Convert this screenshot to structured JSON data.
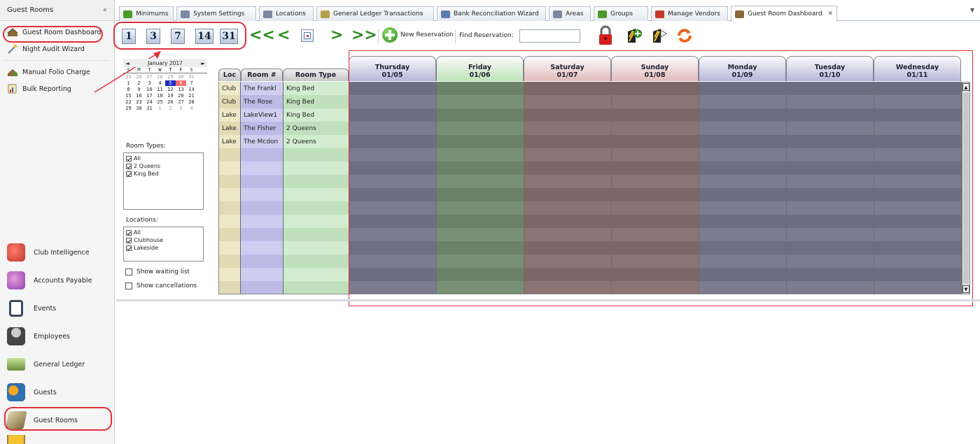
{
  "sidebar": {
    "title": "Guest Rooms",
    "collapse": "«",
    "items": [
      {
        "label": "Guest Room Dashboard",
        "icon": "house-icon"
      },
      {
        "label": "Night Audit Wizard",
        "icon": "wand-icon"
      },
      {
        "label": "Manual Folio Charge",
        "icon": "folio-icon"
      },
      {
        "label": "Bulk Reporting",
        "icon": "report-icon"
      }
    ],
    "modules": [
      {
        "label": "Club Intelligence",
        "icon": "club-intelligence-icon",
        "color": "#c0392b"
      },
      {
        "label": "Accounts Payable",
        "icon": "accounts-payable-icon",
        "color": "#8e44ad"
      },
      {
        "label": "Events",
        "icon": "events-icon",
        "color": "#3a4a63"
      },
      {
        "label": "Employees",
        "icon": "employees-icon",
        "color": "#555555"
      },
      {
        "label": "General Ledger",
        "icon": "general-ledger-icon",
        "color": "#6b8f3a"
      },
      {
        "label": "Guests",
        "icon": "guests-icon",
        "color": "#d35400"
      },
      {
        "label": "Guest Rooms",
        "icon": "guest-rooms-icon",
        "color": "#7d6a3c"
      }
    ]
  },
  "tabs": [
    {
      "label": "Minimums",
      "icon": "minimums-icon",
      "color": "#4c9a2a"
    },
    {
      "label": "System Settings",
      "icon": "settings-icon",
      "color": "#7b8aa0"
    },
    {
      "label": "Locations",
      "icon": "locations-icon",
      "color": "#7b8aa0"
    },
    {
      "label": "General Ledger Transactions",
      "icon": "ledger-icon",
      "color": "#b8a04a"
    },
    {
      "label": "Bank Reconciliation Wizard",
      "icon": "wand-icon",
      "color": "#5b7fb0"
    },
    {
      "label": "Areas",
      "icon": "areas-icon",
      "color": "#7b8aa0"
    },
    {
      "label": "Groups",
      "icon": "groups-icon",
      "color": "#4c9a2a"
    },
    {
      "label": "Manage Vendors",
      "icon": "vendors-icon",
      "color": "#c0392b"
    },
    {
      "label": "Guest Room Dashboard",
      "icon": "house-icon",
      "color": "#8a6a3a",
      "active": true,
      "close": "✕"
    }
  ],
  "toolbar": {
    "day_buttons": [
      "1",
      "3",
      "7",
      "14",
      "31"
    ],
    "prev_week": "<<",
    "prev_day": "<",
    "next_day": ">",
    "next_week": ">>",
    "new_reservation": "New Reservation",
    "find_reservation_label": "Find Reservation:",
    "find_reservation_value": ""
  },
  "mini_calendar": {
    "month": "January 2017",
    "prev": "◄",
    "next": "►",
    "weekdays": [
      "S",
      "M",
      "T",
      "W",
      "T",
      "F",
      "S"
    ],
    "weeks": [
      [
        "25",
        "26",
        "27",
        "28",
        "29",
        "30",
        "31"
      ],
      [
        "1",
        "2",
        "3",
        "4",
        "5",
        "6",
        "7"
      ],
      [
        "8",
        "9",
        "10",
        "11",
        "12",
        "13",
        "14"
      ],
      [
        "15",
        "16",
        "17",
        "18",
        "19",
        "20",
        "21"
      ],
      [
        "22",
        "23",
        "24",
        "25",
        "26",
        "27",
        "28"
      ],
      [
        "29",
        "30",
        "31",
        "1",
        "2",
        "3",
        "4"
      ]
    ],
    "selected_start": "5",
    "selected_end": "6"
  },
  "room_types": {
    "label": "Room Types:",
    "options": [
      {
        "label": "All",
        "checked": true
      },
      {
        "label": "2 Queens",
        "checked": true
      },
      {
        "label": "King Bed",
        "checked": true
      }
    ]
  },
  "locations": {
    "label": "Locations:",
    "options": [
      {
        "label": "All",
        "checked": true
      },
      {
        "label": "Clubhouse",
        "checked": true
      },
      {
        "label": "Lakeside",
        "checked": true
      }
    ]
  },
  "options": {
    "show_waiting_list": "Show waiting list",
    "show_cancellations": "Show cancellations"
  },
  "grid": {
    "columns": {
      "loc": "Loc",
      "room": "Room #",
      "type": "Room Type"
    },
    "days": [
      {
        "day": "Thursday",
        "date": "01/05",
        "color": "#b7b5d9",
        "cell": "#6f6d82",
        "cell_alt": "#7d7b90"
      },
      {
        "day": "Friday",
        "date": "01/06",
        "color": "#bfe3b9",
        "cell": "#6b8268",
        "cell_alt": "#789076"
      },
      {
        "day": "Saturday",
        "date": "01/07",
        "color": "#e3bcbc",
        "cell": "#7e6666",
        "cell_alt": "#8c7474"
      },
      {
        "day": "Sunday",
        "date": "01/08",
        "color": "#e3bcbc",
        "cell": "#7e6666",
        "cell_alt": "#8c7474"
      },
      {
        "day": "Monday",
        "date": "01/09",
        "color": "#b7b5d9",
        "cell": "#6f6d82",
        "cell_alt": "#7d7b90"
      },
      {
        "day": "Tuesday",
        "date": "01/10",
        "color": "#b7b5d9",
        "cell": "#6f6d82",
        "cell_alt": "#7d7b90"
      },
      {
        "day": "Wednesday",
        "date": "01/11",
        "color": "#b7b5d9",
        "cell": "#6f6d82",
        "cell_alt": "#7d7b90"
      }
    ],
    "rooms": [
      {
        "loc": "Club",
        "room": "The Frankl",
        "type": "King Bed"
      },
      {
        "loc": "Club",
        "room": "The Rose",
        "type": "King Bed"
      },
      {
        "loc": "Lake",
        "room": "LakeView1",
        "type": "King Bed"
      },
      {
        "loc": "Lake",
        "room": "The Fisher",
        "type": "2 Queens"
      },
      {
        "loc": "Lake",
        "room": "The Mcdon",
        "type": "2 Queens"
      }
    ],
    "row_count": 16,
    "scroll_up": "▲",
    "scroll_down": "▼"
  }
}
